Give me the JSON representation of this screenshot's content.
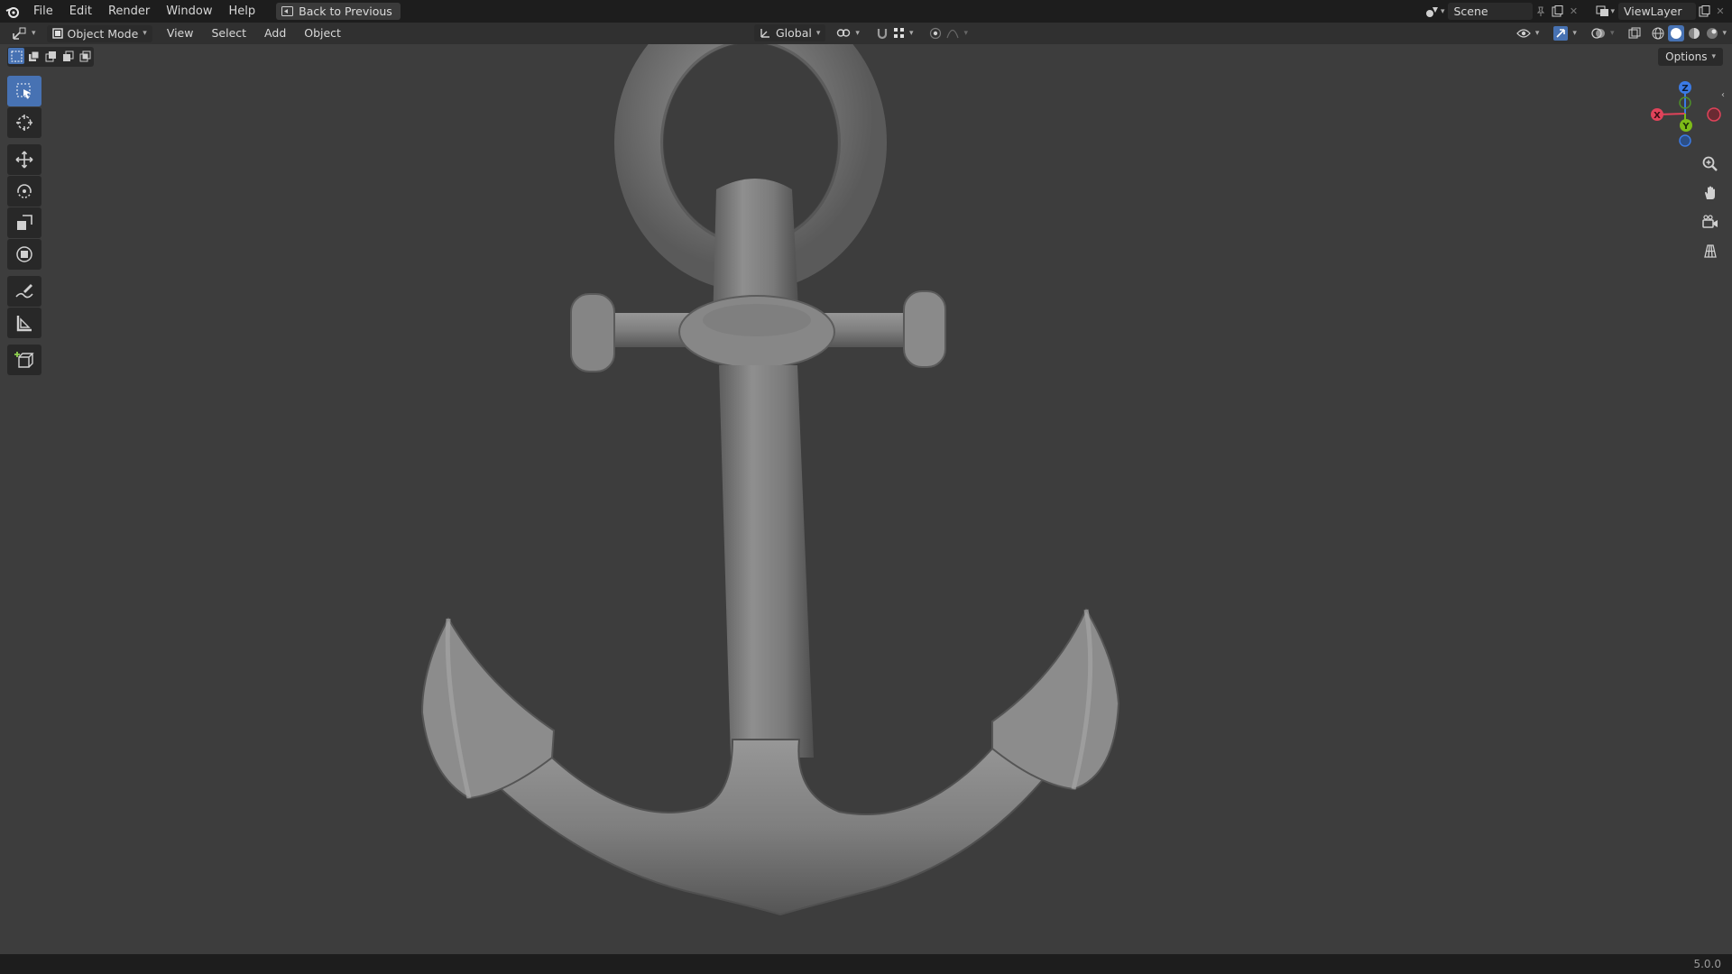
{
  "topbar": {
    "menus": [
      "File",
      "Edit",
      "Render",
      "Window",
      "Help"
    ],
    "back_button": "Back to Previous",
    "scene_name": "Scene",
    "view_layer": "ViewLayer"
  },
  "header": {
    "mode": "Object Mode",
    "menus": [
      "View",
      "Select",
      "Add",
      "Object"
    ],
    "orientation": "Global"
  },
  "options_label": "Options",
  "gizmo": {
    "z": "Z",
    "x": "X",
    "y": "Y"
  },
  "status": {
    "version": "5.0.0"
  },
  "colors": {
    "accent": "#4772b3",
    "axis_x": "#e0435a",
    "axis_y": "#7dbb18",
    "axis_z": "#3b7be6"
  },
  "icons": {
    "toolbar": [
      "select-box-icon",
      "cursor-icon",
      "move-icon",
      "rotate-icon",
      "scale-icon",
      "transform-icon",
      "annotate-icon",
      "measure-icon",
      "add-cube-icon"
    ],
    "navigation": [
      "zoom-icon",
      "pan-hand-icon",
      "camera-icon",
      "ortho-grid-icon"
    ]
  }
}
